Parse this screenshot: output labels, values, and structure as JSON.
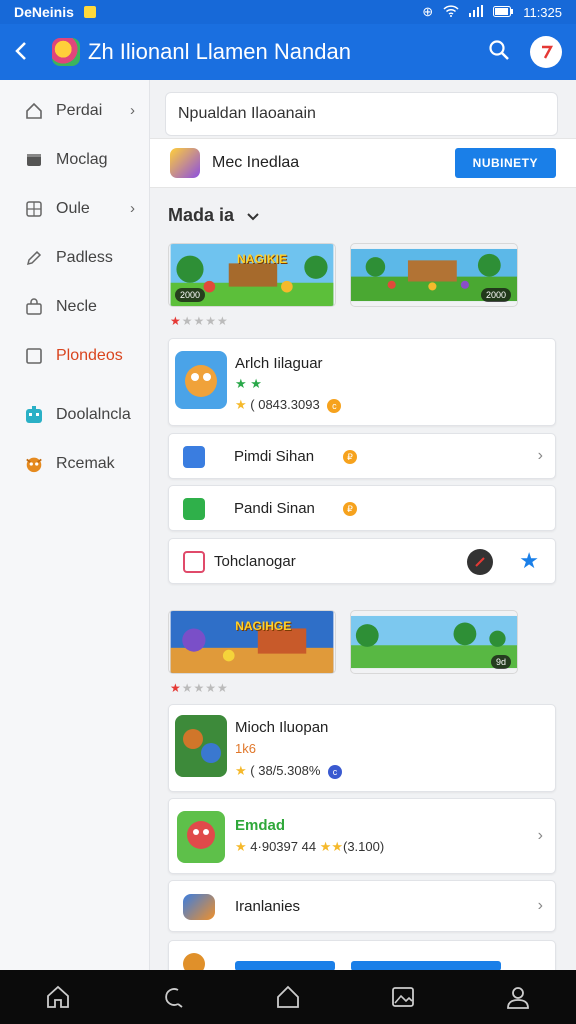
{
  "status_bar": {
    "left_text": "DeNeinis",
    "time": "11:325"
  },
  "app_bar": {
    "title": "Zh Ilionanl Llamen Nandan"
  },
  "sidebar": {
    "items": [
      {
        "label": "Perdai",
        "has_chevron": true,
        "icon": "home-icon"
      },
      {
        "label": "Moclag",
        "has_chevron": false,
        "icon": "folder-icon"
      },
      {
        "label": "Oule",
        "has_chevron": true,
        "icon": "grid-icon"
      },
      {
        "label": "Padless",
        "has_chevron": false,
        "icon": "pencil-icon"
      },
      {
        "label": "Necle",
        "has_chevron": false,
        "icon": "bag-icon"
      },
      {
        "label": "Plondeos",
        "has_chevron": false,
        "icon": "square-icon",
        "active": true
      },
      {
        "label": "Doolalncla",
        "has_chevron": false,
        "icon": "robot-icon"
      },
      {
        "label": "Rcemak",
        "has_chevron": false,
        "icon": "creature-icon"
      }
    ]
  },
  "search": {
    "value": "Npualdan Ilaoanain"
  },
  "featured": {
    "name": "Mec Inedlaa",
    "button": "NUBINETY"
  },
  "section": {
    "title": "Mada ia"
  },
  "group1": {
    "banners": [
      {
        "title": "NAGIKIE",
        "badge": "2000"
      },
      {
        "title": "",
        "badge": "2000"
      }
    ],
    "rating": "★★★★★",
    "app_card": {
      "name": "Arlch Iilaguar",
      "meta": "( 0843.3093"
    },
    "rows": [
      {
        "label": "Pimdi Sihan"
      },
      {
        "label": "Pandi Sinan"
      },
      {
        "label": "Tohclanogar"
      }
    ]
  },
  "group2": {
    "banners": [
      {
        "title": "NAGIHGE",
        "badge": ""
      },
      {
        "title": "",
        "badge": "9d"
      }
    ],
    "rating": "★★★★★",
    "app_card": {
      "name": "Mioch Iluopan",
      "sub": "1k6",
      "meta": "( 38/5.308%"
    },
    "game_card": {
      "name": "Emdad",
      "meta": "4·90397 44",
      "meta2": "(3.100)"
    },
    "row": {
      "label": "Iranlanies"
    }
  },
  "colors": {
    "primary": "#1a6fe0",
    "accent": "#e53935",
    "button": "#1a7fe8"
  }
}
